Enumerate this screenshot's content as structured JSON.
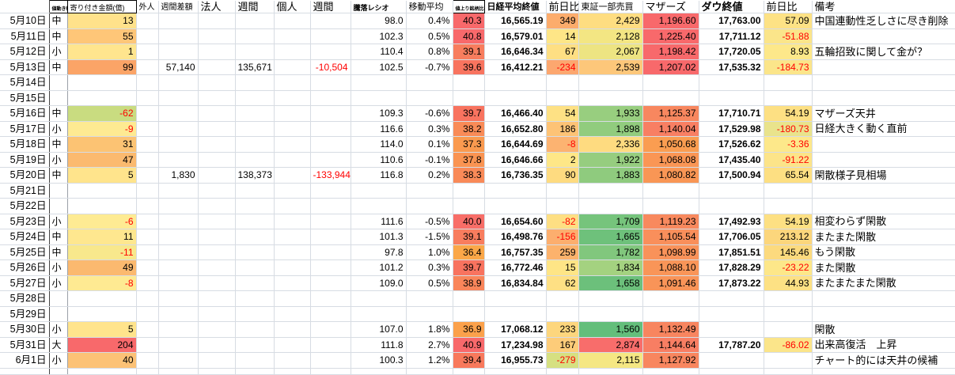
{
  "header": {
    "size_label": "値動き幅",
    "amount": "寄り付き金額(億)",
    "foreign": "外人",
    "foreign_week": "週間差額",
    "corp": "法人",
    "corp_week": "週間",
    "indiv": "個人",
    "indiv_week": "週間",
    "ratio": "騰落レシオ",
    "moving_avg": "移動平均",
    "rising_pct": "値上り銘柄比率",
    "nikkei_close": "日経平均終値",
    "prev_day_diff": "前日比",
    "tosho_volume": "東証一部売買",
    "mothers": "マザーズ",
    "dow_close": "ダウ終値",
    "dow_prev_diff": "前日比",
    "remarks": "備考"
  },
  "colors": {
    "negative_text": "#ff0000",
    "scale_red": "#F8696B",
    "scale_yellow": "#FFEB84",
    "scale_green": "#63BE7B",
    "gridline": "#d7dce3"
  },
  "rows": [
    {
      "date": "5月10日",
      "size": "中",
      "amount": "13",
      "amount_bg": "#FFE28B",
      "ratio": "98.0",
      "ma": "0.4%",
      "rising": "40.3",
      "rising_bg": "#F8696B",
      "nikkei": "16,565.19",
      "diff": "349",
      "diff_bg": "#FCAC6C",
      "tosho": "2,429",
      "tosho_bg": "#FEDD81",
      "mothers": "1,196.60",
      "mothers_bg": "#F8696B",
      "dow": "17,763.00",
      "dow_diff": "57.09",
      "dow_diff_bg": "#FDE285",
      "remarks": "中国連動性乏しさに尽き削除"
    },
    {
      "date": "5月11日",
      "size": "中",
      "amount": "55",
      "amount_bg": "#FEC678",
      "ratio": "102.3",
      "ma": "0.5%",
      "rising": "40.8",
      "rising_bg": "#F8696B",
      "nikkei": "16,579.01",
      "diff": "14",
      "diff_bg": "#FEE687",
      "tosho": "2,128",
      "tosho_bg": "#F3E683",
      "mothers": "1,225.40",
      "mothers_bg": "#F8696B",
      "dow": "17,711.12",
      "dow_diff": "-51.88",
      "dow_diff_bg": "#FBE58A",
      "remarks": ""
    },
    {
      "date": "5月12日",
      "size": "小",
      "amount": "1",
      "amount_bg": "#FFE58E",
      "ratio": "110.4",
      "ma": "0.8%",
      "rising": "39.1",
      "rising_bg": "#F87D5E",
      "nikkei": "16,646.34",
      "diff": "67",
      "diff_bg": "#FEDF83",
      "tosho": "2,067",
      "tosho_bg": "#EDE482",
      "mothers": "1,198.42",
      "mothers_bg": "#F8696B",
      "dow": "17,720.05",
      "dow_diff": "8.93",
      "dow_diff_bg": "#FDE88A",
      "remarks": "五輪招致に関して金が？"
    },
    {
      "date": "5月13日",
      "size": "中",
      "amount": "99",
      "amount_bg": "#FBA467",
      "foreign_week": "57,140",
      "corp_week": "135,671",
      "indiv_week": "-10,504",
      "ratio": "102.5",
      "ma": "-0.7%",
      "rising": "39.6",
      "rising_bg": "#F8745F",
      "nikkei": "16,412.21",
      "diff": "-234",
      "diff_bg": "#FCA76F",
      "tosho": "2,539",
      "tosho_bg": "#FDC77A",
      "mothers": "1,207.02",
      "mothers_bg": "#F8696B",
      "dow": "17,535.32",
      "dow_diff": "-184.73",
      "dow_diff_bg": "#FBE58A",
      "remarks": ""
    },
    {
      "date": "5月14日"
    },
    {
      "date": "5月15日"
    },
    {
      "date": "5月16日",
      "size": "中",
      "amount": "-62",
      "amount_bg": "#C9DC80",
      "ratio": "109.3",
      "ma": "-0.6%",
      "rising": "39.7",
      "rising_bg": "#F8735F",
      "nikkei": "16,466.40",
      "diff": "54",
      "diff_bg": "#FEE184",
      "tosho": "1,933",
      "tosho_bg": "#98CE7F",
      "mothers": "1,125.37",
      "mothers_bg": "#F8875F",
      "dow": "17,710.71",
      "dow_diff": "54.19",
      "dow_diff_bg": "#FDE083",
      "remarks": "マザーズ天井"
    },
    {
      "date": "5月17日",
      "size": "小",
      "amount": "-9",
      "amount_bg": "#FEEA92",
      "ratio": "116.6",
      "ma": "0.3%",
      "rising": "38.2",
      "rising_bg": "#F98B57",
      "nikkei": "16,652.80",
      "diff": "186",
      "diff_bg": "#FDC376",
      "tosho": "1,898",
      "tosho_bg": "#91CC7E",
      "mothers": "1,140.04",
      "mothers_bg": "#F87F63",
      "dow": "17,529.98",
      "dow_diff": "-180.73",
      "dow_diff_bg": "#E9E38C",
      "remarks": "日経大きく動く直前"
    },
    {
      "date": "5月18日",
      "size": "中",
      "amount": "31",
      "amount_bg": "#FCC373",
      "ratio": "114.0",
      "ma": "0.1%",
      "rising": "37.3",
      "rising_bg": "#FA9A4F",
      "nikkei": "16,644.69",
      "diff": "-8",
      "diff_bg": "#FCB371",
      "tosho": "2,336",
      "tosho_bg": "#FEDB80",
      "mothers": "1,050.68",
      "mothers_bg": "#FA9D51",
      "dow": "17,526.62",
      "dow_diff": "-3.36",
      "dow_diff_bg": "#FDE88A",
      "remarks": ""
    },
    {
      "date": "5月19日",
      "size": "小",
      "amount": "47",
      "amount_bg": "#FBBA6F",
      "ratio": "110.6",
      "ma": "-0.1%",
      "rising": "37.8",
      "rising_bg": "#FA9452",
      "nikkei": "16,646.66",
      "diff": "2",
      "diff_bg": "#FEE787",
      "tosho": "1,922",
      "tosho_bg": "#96CD7F",
      "mothers": "1,068.08",
      "mothers_bg": "#FA9655",
      "dow": "17,435.40",
      "dow_diff": "-91.22",
      "dow_diff_bg": "#FCE489",
      "remarks": ""
    },
    {
      "date": "5月20日",
      "size": "中",
      "amount": "5",
      "amount_bg": "#FFE48C",
      "foreign_week": "1,830",
      "corp_week": "138,373",
      "indiv_week": "-133,944",
      "ratio": "116.8",
      "ma": "0.2%",
      "rising": "38.3",
      "rising_bg": "#F98A58",
      "nikkei": "16,736.35",
      "diff": "90",
      "diff_bg": "#FEDB80",
      "tosho": "1,883",
      "tosho_bg": "#8FCB7E",
      "mothers": "1,080.82",
      "mothers_bg": "#F99655",
      "dow": "17,500.94",
      "dow_diff": "65.54",
      "dow_diff_bg": "#FDDF82",
      "remarks": "閑散様子見相場"
    },
    {
      "date": "5月21日"
    },
    {
      "date": "5月22日"
    },
    {
      "date": "5月23日",
      "size": "小",
      "amount": "-6",
      "amount_bg": "#FEEB93",
      "ratio": "111.6",
      "ma": "-0.5%",
      "rising": "40.0",
      "rising_bg": "#F86E68",
      "nikkei": "16,654.60",
      "diff": "-82",
      "diff_bg": "#FEDF83",
      "tosho": "1,709",
      "tosho_bg": "#76C47C",
      "mothers": "1,119.23",
      "mothers_bg": "#F8895E",
      "dow": "17,492.93",
      "dow_diff": "54.19",
      "dow_diff_bg": "#FDE083",
      "remarks": "相変わらず閑散"
    },
    {
      "date": "5月24日",
      "size": "中",
      "amount": "11",
      "amount_bg": "#FEE78F",
      "ratio": "101.3",
      "ma": "-1.5%",
      "rising": "39.1",
      "rising_bg": "#F87D5E",
      "nikkei": "16,498.76",
      "diff": "-156",
      "diff_bg": "#FCAE6E",
      "tosho": "1,665",
      "tosho_bg": "#6EC17B",
      "mothers": "1,105.54",
      "mothers_bg": "#F98F5B",
      "dow": "17,706.05",
      "dow_diff": "213.12",
      "dow_diff_bg": "#FCD67C",
      "remarks": "またまた閑散"
    },
    {
      "date": "5月25日",
      "size": "中",
      "amount": "-11",
      "amount_bg": "#F8E88C",
      "ratio": "97.8",
      "ma": "1.0%",
      "rising": "36.4",
      "rising_bg": "#FBA748",
      "nikkei": "16,757.35",
      "diff": "259",
      "diff_bg": "#FCB26C",
      "tosho": "1,782",
      "tosho_bg": "#81C77D",
      "mothers": "1,098.99",
      "mothers_bg": "#F9925A",
      "dow": "17,851.51",
      "dow_diff": "145.46",
      "dow_diff_bg": "#FCDA7E",
      "remarks": "もう閑散"
    },
    {
      "date": "5月26日",
      "size": "小",
      "amount": "49",
      "amount_bg": "#FBB96F",
      "ratio": "101.2",
      "ma": "0.3%",
      "rising": "39.7",
      "rising_bg": "#F8735F",
      "nikkei": "16,772.46",
      "diff": "15",
      "diff_bg": "#FEE586",
      "tosho": "1,834",
      "tosho_bg": "#A4D280",
      "mothers": "1,088.10",
      "mothers_bg": "#F99558",
      "dow": "17,828.29",
      "dow_diff": "-23.22",
      "dow_diff_bg": "#FDE789",
      "remarks": "また閑散"
    },
    {
      "date": "5月27日",
      "size": "小",
      "amount": "-8",
      "amount_bg": "#FEEA92",
      "ratio": "109.0",
      "ma": "0.5%",
      "rising": "38.9",
      "rising_bg": "#F9855A",
      "nikkei": "16,834.84",
      "diff": "62",
      "diff_bg": "#FEE084",
      "tosho": "1,658",
      "tosho_bg": "#6CC07B",
      "mothers": "1,091.46",
      "mothers_bg": "#F99458",
      "dow": "17,873.22",
      "dow_diff": "44.93",
      "dow_diff_bg": "#FDE184",
      "remarks": "またまたまた閑散"
    },
    {
      "date": "5月28日"
    },
    {
      "date": "5月29日"
    },
    {
      "date": "5月30日",
      "size": "小",
      "amount": "5",
      "amount_bg": "#FFE48C",
      "ratio": "107.0",
      "ma": "1.8%",
      "rising": "36.9",
      "rising_bg": "#FBA14B",
      "nikkei": "17,068.12",
      "diff": "233",
      "diff_bg": "#FDD67D",
      "tosho": "1,560",
      "tosho_bg": "#63BE7B",
      "mothers": "1,132.49",
      "mothers_bg": "#F8855F",
      "dow": "",
      "dow_diff": "",
      "remarks": "閑散"
    },
    {
      "date": "5月31日",
      "size": "大",
      "amount": "204",
      "amount_bg": "#F8696B",
      "ratio": "111.8",
      "ma": "2.7%",
      "rising": "40.9",
      "rising_bg": "#F8696B",
      "nikkei": "17,234.98",
      "diff": "167",
      "diff_bg": "#FDCC79",
      "tosho": "2,874",
      "tosho_bg": "#F86D6B",
      "mothers": "1,144.64",
      "mothers_bg": "#F87E63",
      "dow": "17,787.20",
      "dow_diff": "-86.02",
      "dow_diff_bg": "#FBE58A",
      "remarks": "出来高復活　上昇"
    },
    {
      "date": "6月1日",
      "size": "小",
      "amount": "40",
      "amount_bg": "#FCC276",
      "ratio": "100.3",
      "ma": "1.2%",
      "rising": "39.4",
      "rising_bg": "#F8795C",
      "nikkei": "16,955.73",
      "diff": "-279",
      "diff_bg": "#D6E081",
      "tosho": "2,115",
      "tosho_bg": "#F5E783",
      "mothers": "1,127.92",
      "mothers_bg": "#F8865F",
      "dow": "",
      "dow_diff": "",
      "remarks": "チャート的には天井の候補"
    }
  ]
}
